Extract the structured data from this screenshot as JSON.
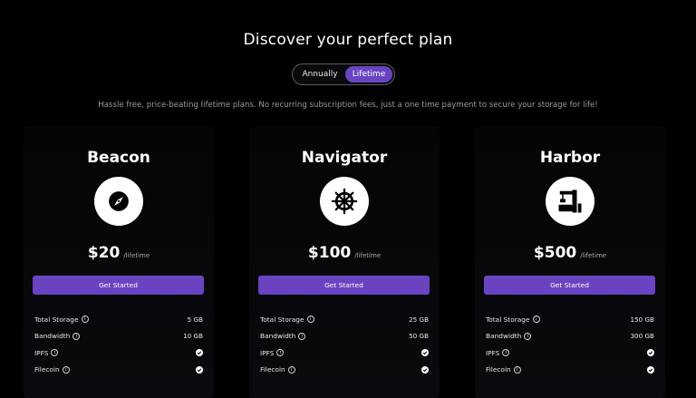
{
  "header": {
    "title": "Discover your perfect plan",
    "subtitle": "Hassle free, price-beating lifetime plans. No recurring subscription fees, just a one time payment to secure your storage for life!"
  },
  "billing_toggle": {
    "options": [
      "Annually",
      "Lifetime"
    ],
    "selected": "Lifetime"
  },
  "plans": [
    {
      "name": "Beacon",
      "icon": "compass-icon",
      "price": "$20",
      "period": "/lifetime",
      "cta": "Get Started",
      "features": [
        {
          "label": "Total Storage",
          "value": "5 GB"
        },
        {
          "label": "Bandwidth",
          "value": "10 GB"
        },
        {
          "label": "IPFS",
          "value": "included"
        },
        {
          "label": "Filecoin",
          "value": "included"
        }
      ]
    },
    {
      "name": "Navigator",
      "icon": "ship-wheel-icon",
      "price": "$100",
      "period": "/lifetime",
      "cta": "Get Started",
      "features": [
        {
          "label": "Total Storage",
          "value": "25 GB"
        },
        {
          "label": "Bandwidth",
          "value": "50 GB"
        },
        {
          "label": "IPFS",
          "value": "included"
        },
        {
          "label": "Filecoin",
          "value": "included"
        }
      ]
    },
    {
      "name": "Harbor",
      "icon": "harbor-crane-icon",
      "price": "$500",
      "period": "/lifetime",
      "cta": "Get Started",
      "features": [
        {
          "label": "Total Storage",
          "value": "150 GB"
        },
        {
          "label": "Bandwidth",
          "value": "300 GB"
        },
        {
          "label": "IPFS",
          "value": "included"
        },
        {
          "label": "Filecoin",
          "value": "included"
        }
      ]
    }
  ],
  "colors": {
    "background": "#000000",
    "accent": "#6a44c0",
    "text": "#ffffff",
    "muted": "#9a9aa3"
  }
}
